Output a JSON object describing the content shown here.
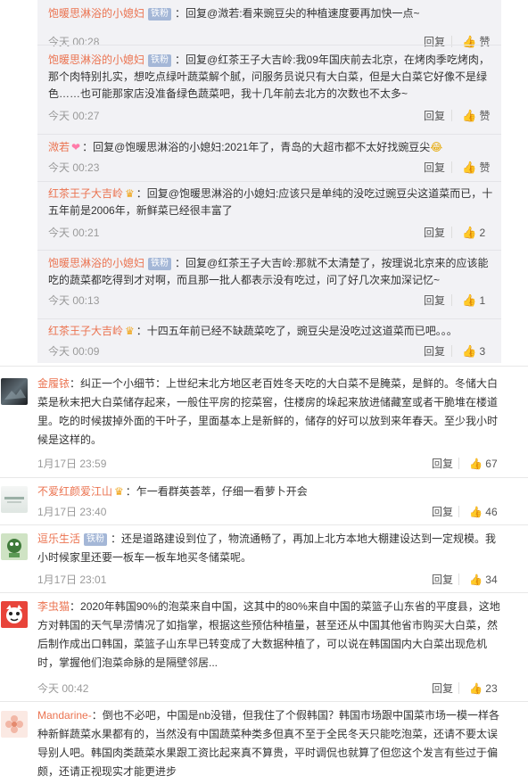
{
  "replies": [
    {
      "user": "饱暖思淋浴的小媳妇",
      "badge": "铁粉",
      "text": "：回复@溦若:看来豌豆尖的种植速度要再加快一点~",
      "time": "今天 00:28",
      "reply": "回复",
      "like": "赞"
    },
    {
      "user": "饱暖思淋浴的小媳妇",
      "badge": "铁粉",
      "text": "：回复@红茶王子大吉岭:我09年国庆前去北京，在烤肉季吃烤肉，那个肉特别扎实，想吃点绿叶蔬菜解个腻，问服务员说只有大白菜，但是大白菜它好像不是绿色……也可能那家店没准备绿色蔬菜吧，我十几年前去北方的次数也不太多~",
      "time": "今天 00:27",
      "reply": "回复",
      "like": "赞"
    },
    {
      "user": "溦若",
      "heart": "❤",
      "text": "：回复@饱暖思淋浴的小媳妇:2021年了，青岛的大超市都不太好找豌豆尖",
      "emoji": "😂",
      "time": "今天 00:23",
      "reply": "回复",
      "like": "赞"
    },
    {
      "user": "红茶王子大吉岭",
      "crown": "♛",
      "text": "：回复@饱暖思淋浴的小媳妇:应该只是单纯的没吃过豌豆尖这道菜而已，十五年前是2006年，新鲜菜已经很丰富了",
      "time": "今天 00:21",
      "reply": "回复",
      "like": "2"
    },
    {
      "user": "饱暖思淋浴的小媳妇",
      "badge": "铁粉",
      "text": "：回复@红茶王子大吉岭:那就不太清楚了，按理说北京来的应该能吃的蔬菜都吃得到才对啊，而且那一批人都表示没有吃过，问了好几次来加深记忆~",
      "time": "今天 00:13",
      "reply": "回复",
      "like": "1"
    },
    {
      "user": "红茶王子大吉岭",
      "crown": "♛",
      "text": "：十四五年前已经不缺蔬菜吃了，豌豆尖是没吃过这道菜而已吧。。。",
      "time": "今天 00:09",
      "reply": "回复",
      "like": "3"
    }
  ],
  "comments": [
    {
      "user": "金履铱",
      "text": "：纠正一个小细节：上世纪末北方地区老百姓冬天吃的大白菜不是腌菜，是鲜的。冬储大白菜是秋末把大白菜储存起来，一般住平房的挖菜窖，住楼房的垛起来放进储藏室或者干脆堆在楼道里。吃的时候拔掉外面的干叶子，里面基本上是新鲜的，储存的好可以放到来年春天。至少我小时候是这样的。",
      "time": "1月17日 23:59",
      "reply": "回复",
      "like": "67"
    },
    {
      "user": "不爱红颜爱江山",
      "crown": "♛",
      "text": "：乍一看群英荟萃，仔细一看萝卜开会",
      "time": "1月17日 23:40",
      "reply": "回复",
      "like": "46"
    },
    {
      "user": "逗乐生活",
      "badge": "铁粉",
      "text": "：还是道路建设到位了，物流通畅了，再加上北方本地大棚建设达到一定规模。我小时候家里还要一板车一板车地买冬储菜呢。",
      "time": "1月17日 23:01",
      "reply": "回复",
      "like": "34"
    },
    {
      "user": "李虫猫",
      "text": "：2020年韩国90%的泡菜来自中国，这其中的80%来自中国的菜篮子山东省的平度县，这地方对韩国的天气旱涝情况了如指掌，根据这些预估种植量，甚至还从中国其他省市购买大白菜，然后制作成出口韩国，菜篮子山东早已转变成了大数据种植了，可以说在韩国国内大白菜出现危机时，掌握他们泡菜命脉的是隔壁邻居...",
      "time": "今天 00:42",
      "reply": "回复",
      "like": "23"
    },
    {
      "user": "Mandarine-",
      "text": "：倒也不必吧，中国是nb没错，但我住了个假韩国？韩国市场跟中国菜市场一模一样各种新鲜蔬菜水果都有的，当然没有中国蔬菜种类多但真不至于全民冬天只能吃泡菜，还请不要太误导别人吧。韩国肉类蔬菜水果跟工资比起来真不算贵，平时调侃也就算了但您这个发言有些过于偏颇，还请正视现实才能更进步"
    }
  ],
  "colors": {
    "name": "#eb7350",
    "badge": "#a4b7d7",
    "meta": "#9a9a9a",
    "subbg": "#f2f2f5"
  }
}
